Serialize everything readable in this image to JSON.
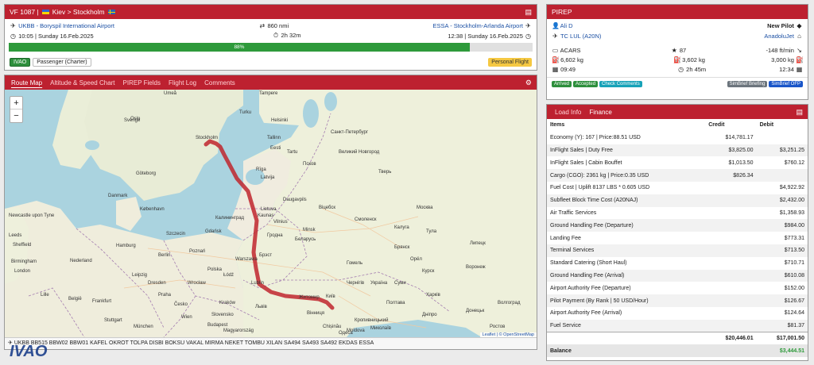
{
  "flight": {
    "callsign": "VF 1087 |",
    "route_title": "Kiev > Stockholm",
    "dep_airport": "UKBB - Boryspil International Airport",
    "arr_airport": "ESSA - Stockholm-Arlanda Airport",
    "distance": "860 nmi",
    "dep_time": "10:05 | Sunday 16.Feb.2025",
    "duration": "2h 32m",
    "arr_time": "12:38 | Sunday 16.Feb.2025",
    "progress_label": "88%",
    "progress": 0.88,
    "network_badge": "IVAO",
    "flight_type": "Passenger (Charter)",
    "personal_flight": "Personal Flight"
  },
  "map_card": {
    "tabs": [
      "Route Map",
      "Altitude & Speed Chart",
      "PIREP Fields",
      "Flight Log",
      "Comments"
    ],
    "zoom_in": "+",
    "zoom_out": "−",
    "attribution_leaflet": "Leaflet",
    "attribution_osm": "| © OpenStreetMap",
    "route_string": "UKBB BB515 BBW02 BBW01 KAFEL OKROT TOLPA DISBI BOKSU VAKAL MIRMA NEKET TOMBU XILAN SA494 SA493 SA492 EKDAS ESSA",
    "watermark": "IVAO",
    "labels": {
      "sweden": "Sverige",
      "stockholm": "Stockholm",
      "oslo": "Oslo",
      "tampere": "Tampere",
      "helsinki": "Helsinki",
      "tallinn": "Tallinn",
      "eesti": "Eesti",
      "latvija": "Latvija",
      "riga": "Rīga",
      "lietuva": "Lietuva",
      "vilnius": "Vilnius",
      "minsk": "Minsk",
      "belarus": "Беларусь",
      "moscow": "Москва",
      "polska": "Polska",
      "warszawa": "Warszawa",
      "kyiv": "Київ",
      "ukraine": "Україна",
      "danmark": "Danmark",
      "kobenhavn": "København",
      "berlin": "Berlin",
      "hamburg": "Hamburg",
      "gdansk": "Gdańsk",
      "kaliningrad": "Калининград",
      "praha": "Praha",
      "wien": "Wien",
      "muenchen": "München",
      "budapest": "Budapest",
      "nederland": "Nederland",
      "ceska": "Česko",
      "stpetersburg": "Санкт-Петербург",
      "smolensk": "Смоленск",
      "bryansk": "Брянск",
      "kursk": "Курск",
      "kharkiv": "Харків",
      "voronezh": "Воронеж",
      "lodz": "Łódź",
      "krakow": "Kraków",
      "lublin": "Lublin",
      "goteborg": "Göteborg",
      "newcastle": "Newcastle upon Tyne",
      "leeds": "Leeds",
      "london": "London",
      "birmingham": "Birmingham",
      "sheffield": "Sheffield",
      "lille": "Lille",
      "belgique": "België",
      "frankfurt": "Frankfurt",
      "stuttgart": "Stuttgart",
      "dnipro": "Дніпро",
      "moldova": "Moldova",
      "slovensko": "Slovensko",
      "magyarorszag": "Magyarország",
      "chisinau": "Chișinău",
      "tver": "Тверь",
      "kaluga": "Калуга",
      "tula": "Тула",
      "lipetsk": "Липецк",
      "orel": "Орёл",
      "pskov": "Псков",
      "novgorod": "Великий Новгород",
      "vitebsk": "Віцебск",
      "gomel": "Гомель",
      "brest": "Брэст",
      "grodno": "Гродна",
      "poznan": "Poznań",
      "szczecin": "Szczecin",
      "wroclaw": "Wrocław",
      "dresden": "Dresden",
      "leipzig": "Leipzig",
      "zhytomyr": "Житомир",
      "vinnytsia": "Вінниця",
      "lviv": "Львів",
      "poltava": "Полтава",
      "chernihiv": "Чернігів",
      "sumy": "Суми",
      "kropyvnytskyi": "Кропивницький",
      "mykolaiv": "Миколаїв",
      "odesa": "Одеса",
      "donetsk": "Донецьк",
      "rostov": "Ростов",
      "volgograd": "Волгоград",
      "kaunas": "Kaunas",
      "daugavpils": "Daugavpils",
      "tartu": "Tartu",
      "turku": "Turku",
      "umea": "Umeå"
    }
  },
  "pirep": {
    "title": "PIREP",
    "pilot": "Ali D",
    "pilot_rank": "New Pilot",
    "aircraft": "TC LUL (A20N)",
    "airline": "AnadoluJet",
    "source": "ACARS",
    "score": "87",
    "landing_rate": "-148 ft/min",
    "fuel_used": "6,602 kg",
    "fuel_remaining": "3,602 kg",
    "block_fuel": "3,000 kg",
    "block_off": "09:49",
    "flight_time": "2h 45m",
    "block_on": "12:34",
    "badges": [
      {
        "label": "Arrived",
        "bg": "#2d8f3c",
        "fg": "#ffffff"
      },
      {
        "label": "Accepted",
        "bg": "#2d8f3c",
        "fg": "#ffffff"
      },
      {
        "label": "Check Comments",
        "bg": "#17a2b8",
        "fg": "#ffffff"
      }
    ],
    "badges_right": [
      {
        "label": "SimBrief Briefing",
        "bg": "#6c757d",
        "fg": "#ffffff"
      },
      {
        "label": "SimBrief OFP",
        "bg": "#1a56c9",
        "fg": "#ffffff"
      }
    ]
  },
  "finance": {
    "tab_load": "Load Info",
    "tab_finance": "Finance",
    "col_items": "Items",
    "col_credit": "Credit",
    "col_debit": "Debit",
    "rows": [
      {
        "item": "Economy (Y): 167 | Price:88.51 USD",
        "credit": "$14,781.17",
        "debit": ""
      },
      {
        "item": "InFlight Sales | Duty Free",
        "credit": "$3,825.00",
        "debit": "$3,251.25"
      },
      {
        "item": "InFlight Sales | Cabin Bouffet",
        "credit": "$1,013.50",
        "debit": "$760.12"
      },
      {
        "item": "Cargo (CGO): 2361 kg | Price:0.35 USD",
        "credit": "$826.34",
        "debit": ""
      },
      {
        "item": "Fuel Cost | Uplift 8137 LBS * 0.605 USD",
        "credit": "",
        "debit": "$4,922.92"
      },
      {
        "item": "Subfleet Block Time Cost (A20NAJ)",
        "credit": "",
        "debit": "$2,432.00"
      },
      {
        "item": "Air Traffic Services",
        "credit": "",
        "debit": "$1,358.93"
      },
      {
        "item": "Ground Handling Fee (Departure)",
        "credit": "",
        "debit": "$984.00"
      },
      {
        "item": "Landing Fee",
        "credit": "",
        "debit": "$773.31"
      },
      {
        "item": "Terminal Services",
        "credit": "",
        "debit": "$713.50"
      },
      {
        "item": "Standard Catering (Short Haul)",
        "credit": "",
        "debit": "$710.71"
      },
      {
        "item": "Ground Handling Fee (Arrival)",
        "credit": "",
        "debit": "$610.08"
      },
      {
        "item": "Airport Authority Fee (Departure)",
        "credit": "",
        "debit": "$152.00"
      },
      {
        "item": "Pilot Payment (By Rank | 50 USD/Hour)",
        "credit": "",
        "debit": "$126.67"
      },
      {
        "item": "Airport Authority Fee (Arrival)",
        "credit": "",
        "debit": "$124.64"
      },
      {
        "item": "Fuel Service",
        "credit": "",
        "debit": "$81.37"
      }
    ],
    "total_credit": "$20,446.01",
    "total_debit": "$17,001.50",
    "balance_label": "Balance",
    "balance": "$3,444.51"
  }
}
